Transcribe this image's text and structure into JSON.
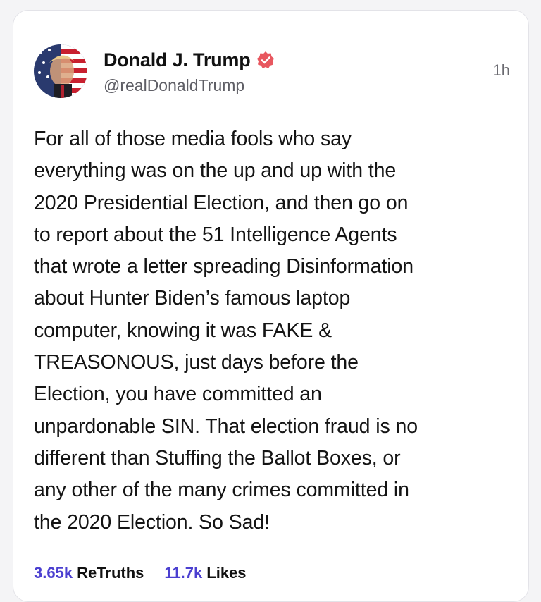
{
  "post": {
    "author_name": "Donald J. Trump",
    "handle": "@realDonaldTrump",
    "timestamp": "1h",
    "verified_badge": "check-badge-icon",
    "body": "For all of those media fools who say\neverything was on the up and up with the\n2020 Presidential Election, and then go on\nto report about the 51 Intelligence Agents\nthat wrote a letter spreading Disinformation\nabout Hunter Biden’s famous laptop\ncomputer, knowing it was FAKE &\nTREASONOUS, just days before the\nElection, you have committed an\nunpardonable SIN. That election fraud is no\ndifferent than Stuffing the Ballot Boxes, or\nany other of the many crimes committed in\nthe 2020 Election. So Sad!"
  },
  "stats": {
    "retruths_count": "3.65k",
    "retruths_label": "ReTruths",
    "likes_count": "11.7k",
    "likes_label": "Likes"
  },
  "colors": {
    "accent": "#4b3fd0",
    "badge": "#e8575f"
  }
}
